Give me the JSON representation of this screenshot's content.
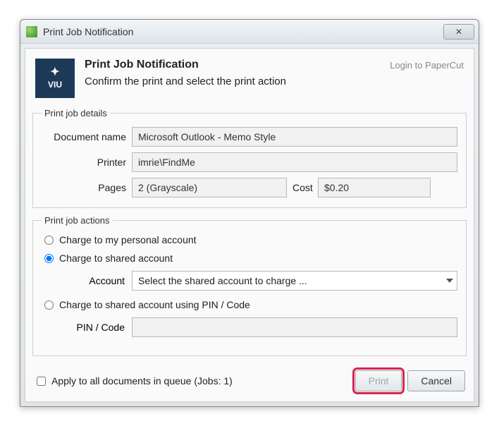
{
  "window": {
    "title": "Print Job Notification"
  },
  "header": {
    "logo_text": "VIU",
    "title": "Print Job Notification",
    "subtitle": "Confirm the print and select the print action",
    "login_link": "Login to PaperCut"
  },
  "details": {
    "legend": "Print job details",
    "document_label": "Document name",
    "document_value": "Microsoft Outlook - Memo Style",
    "printer_label": "Printer",
    "printer_value": "imrie\\FindMe",
    "pages_label": "Pages",
    "pages_value": "2  (Grayscale)",
    "cost_label": "Cost",
    "cost_value": "$0.20"
  },
  "actions": {
    "legend": "Print job actions",
    "option_personal": "Charge to my personal account",
    "option_shared": "Charge to shared account",
    "account_label": "Account",
    "account_value": "Select the shared account to charge ...",
    "option_pin": "Charge to shared account using PIN / Code",
    "pin_label": "PIN / Code"
  },
  "footer": {
    "apply_all": "Apply to all documents in queue (Jobs: 1)",
    "print": "Print",
    "cancel": "Cancel"
  }
}
